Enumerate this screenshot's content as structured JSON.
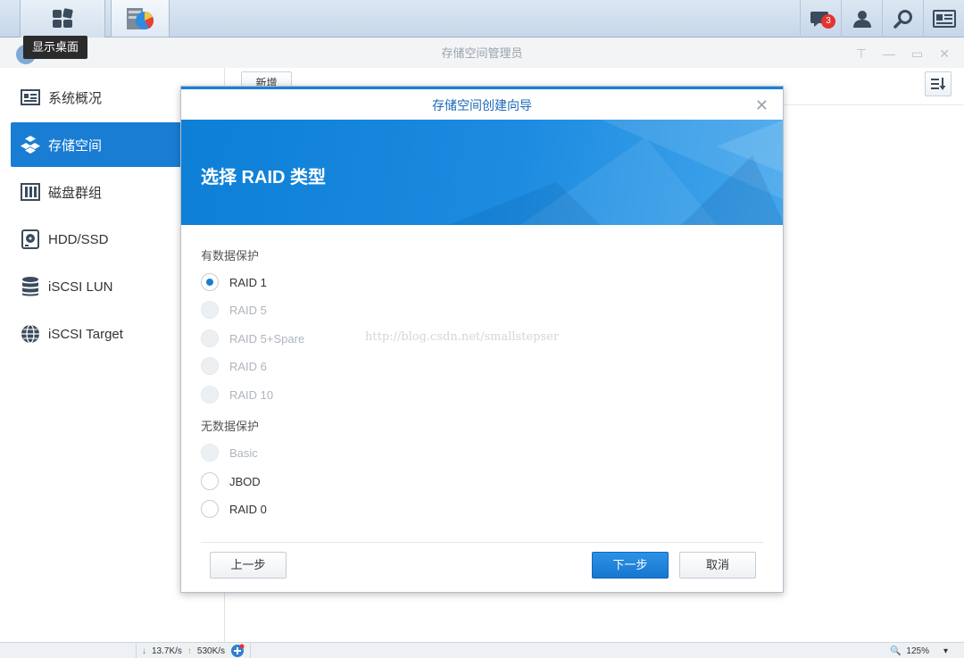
{
  "taskbar": {
    "home_tooltip": "显示桌面",
    "notification_count": "3"
  },
  "window": {
    "title": "存储空间管理员"
  },
  "sidebar": {
    "items": [
      {
        "label": "系统概况",
        "icon": "overview-icon"
      },
      {
        "label": "存储空间",
        "icon": "storage-icon"
      },
      {
        "label": "磁盘群组",
        "icon": "disk-group-icon"
      },
      {
        "label": "HDD/SSD",
        "icon": "hdd-icon"
      },
      {
        "label": "iSCSI LUN",
        "icon": "database-icon"
      },
      {
        "label": "iSCSI Target",
        "icon": "globe-icon"
      }
    ]
  },
  "toolbar": {
    "new_label": "新增"
  },
  "dialog": {
    "title": "存储空间创建向导",
    "heading": "选择 RAID 类型",
    "section_protected": "有数据保护",
    "section_unprotected": "无数据保护",
    "options_protected": [
      {
        "label": "RAID 1",
        "state": "checked"
      },
      {
        "label": "RAID 5",
        "state": "disabled"
      },
      {
        "label": "RAID 5+Spare",
        "state": "disabled"
      },
      {
        "label": "RAID 6",
        "state": "disabled"
      },
      {
        "label": "RAID 10",
        "state": "disabled"
      }
    ],
    "options_unprotected": [
      {
        "label": "Basic",
        "state": "disabled"
      },
      {
        "label": "JBOD",
        "state": "enabled"
      },
      {
        "label": "RAID 0",
        "state": "enabled"
      }
    ],
    "watermark": "http://blog.csdn.net/smallstepser",
    "back_label": "上一步",
    "next_label": "下一步",
    "cancel_label": "取消"
  },
  "statusbar": {
    "download": "13.7K/s",
    "upload": "530K/s",
    "zoom": "125%"
  },
  "colors": {
    "accent": "#1a7dd4",
    "banner": "#0d7fd6"
  }
}
